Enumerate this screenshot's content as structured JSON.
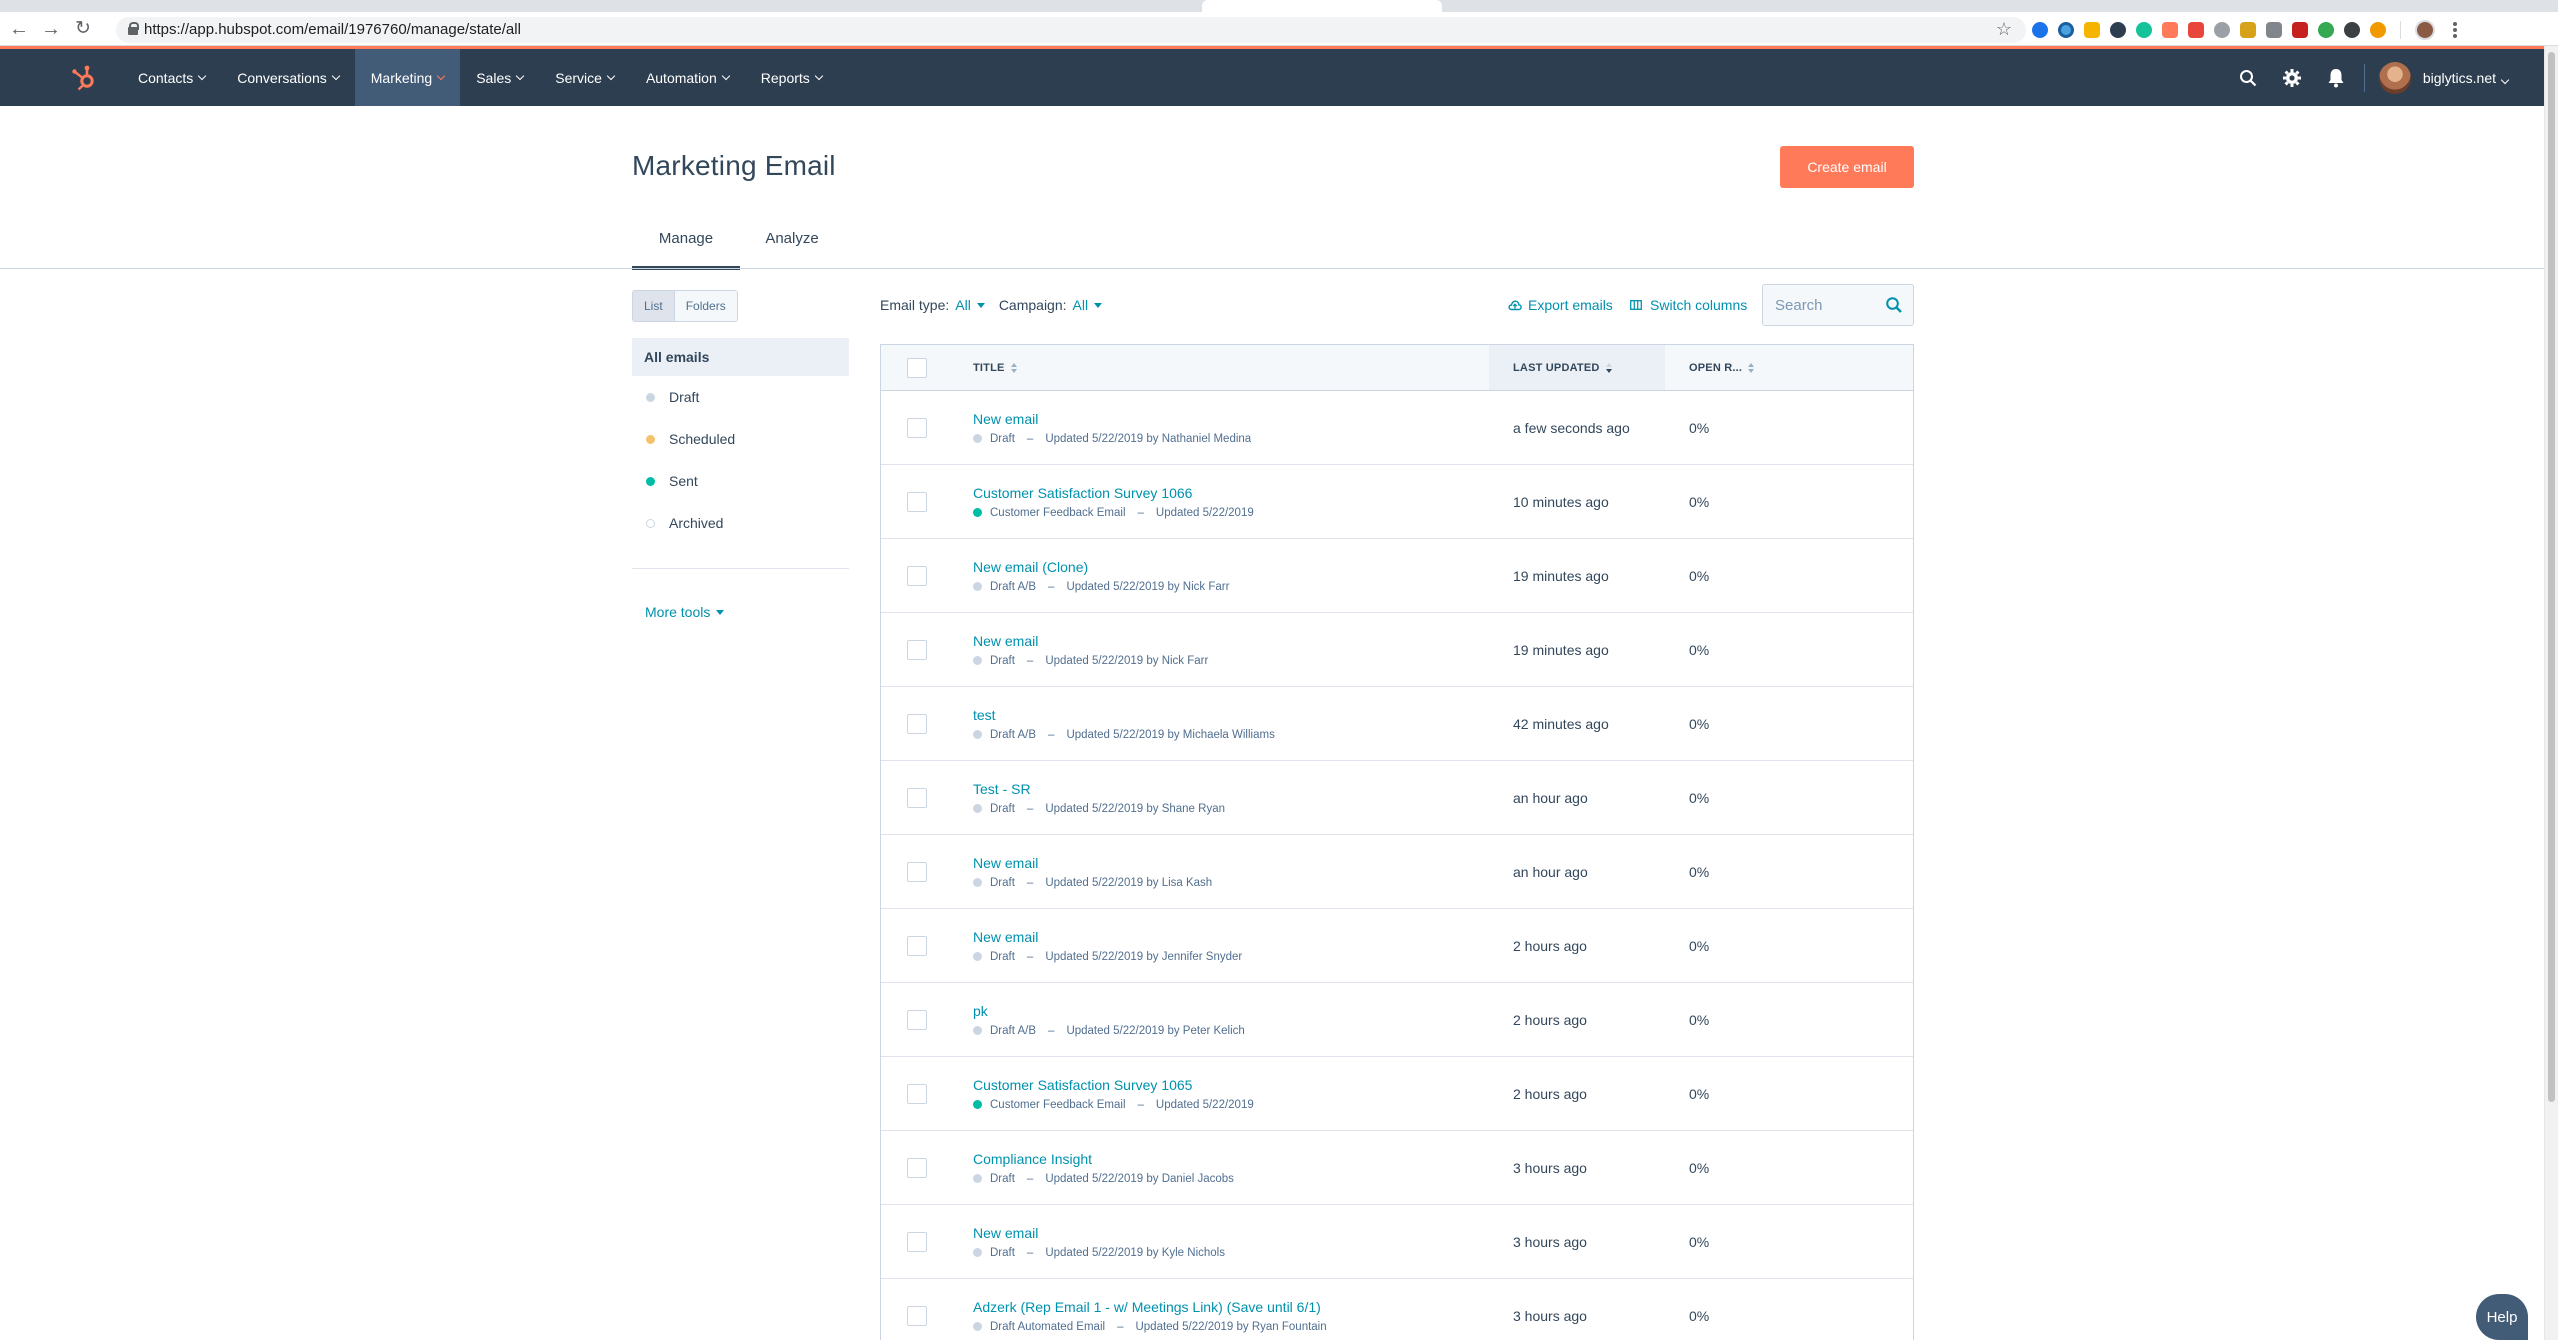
{
  "browser": {
    "url": "https://app.hubspot.com/email/1976760/manage/state/all"
  },
  "nav": {
    "items": [
      {
        "label": "Contacts",
        "name": "nav-contacts"
      },
      {
        "label": "Conversations",
        "name": "nav-conversations"
      },
      {
        "label": "Marketing",
        "name": "nav-marketing",
        "active": true
      },
      {
        "label": "Sales",
        "name": "nav-sales"
      },
      {
        "label": "Service",
        "name": "nav-service"
      },
      {
        "label": "Automation",
        "name": "nav-automation"
      },
      {
        "label": "Reports",
        "name": "nav-reports"
      }
    ],
    "account": "biglytics.net"
  },
  "page": {
    "title": "Marketing Email",
    "create_button": "Create email",
    "tabs": [
      "Manage",
      "Analyze"
    ]
  },
  "sidebar": {
    "toggle": [
      "List",
      "Folders"
    ],
    "items": [
      {
        "label": "All emails",
        "dot": ""
      },
      {
        "label": "Draft",
        "dot": "#cbd6e2"
      },
      {
        "label": "Scheduled",
        "dot": "#f5c26b"
      },
      {
        "label": "Sent",
        "dot": "#00bda5"
      },
      {
        "label": "Archived",
        "dot": "outline"
      }
    ],
    "more_tools": "More tools"
  },
  "filters": {
    "email_type_label": "Email type:",
    "email_type_value": "All",
    "campaign_label": "Campaign:",
    "campaign_value": "All",
    "export": "Export emails",
    "switch_columns": "Switch columns",
    "search_placeholder": "Search"
  },
  "table": {
    "headers": {
      "title": "TITLE",
      "last_updated": "LAST UPDATED",
      "open_rate": "OPEN R..."
    },
    "rows": [
      {
        "title": "New email",
        "status": "Draft",
        "dot": "#cbd6e2",
        "updated": "Updated 5/22/2019 by Nathaniel Medina",
        "last_updated": "a few seconds ago",
        "open_rate": "0%"
      },
      {
        "title": "Customer Satisfaction Survey 1066",
        "status": "Customer Feedback Email",
        "dot": "#00bda5",
        "updated": "Updated 5/22/2019",
        "last_updated": "10 minutes ago",
        "open_rate": "0%"
      },
      {
        "title": "New email (Clone)",
        "status": "Draft A/B",
        "dot": "#cbd6e2",
        "updated": "Updated 5/22/2019 by Nick Farr",
        "last_updated": "19 minutes ago",
        "open_rate": "0%"
      },
      {
        "title": "New email",
        "status": "Draft",
        "dot": "#cbd6e2",
        "updated": "Updated 5/22/2019 by Nick Farr",
        "last_updated": "19 minutes ago",
        "open_rate": "0%"
      },
      {
        "title": "test",
        "status": "Draft A/B",
        "dot": "#cbd6e2",
        "updated": "Updated 5/22/2019 by Michaela Williams",
        "last_updated": "42 minutes ago",
        "open_rate": "0%"
      },
      {
        "title": "Test - SR",
        "status": "Draft",
        "dot": "#cbd6e2",
        "updated": "Updated 5/22/2019 by Shane Ryan",
        "last_updated": "an hour ago",
        "open_rate": "0%"
      },
      {
        "title": "New email",
        "status": "Draft",
        "dot": "#cbd6e2",
        "updated": "Updated 5/22/2019 by Lisa Kash",
        "last_updated": "an hour ago",
        "open_rate": "0%"
      },
      {
        "title": "New email",
        "status": "Draft",
        "dot": "#cbd6e2",
        "updated": "Updated 5/22/2019 by Jennifer Snyder",
        "last_updated": "2 hours ago",
        "open_rate": "0%"
      },
      {
        "title": "pk",
        "status": "Draft A/B",
        "dot": "#cbd6e2",
        "updated": "Updated 5/22/2019 by Peter Kelich",
        "last_updated": "2 hours ago",
        "open_rate": "0%"
      },
      {
        "title": "Customer Satisfaction Survey 1065",
        "status": "Customer Feedback Email",
        "dot": "#00bda5",
        "updated": "Updated 5/22/2019",
        "last_updated": "2 hours ago",
        "open_rate": "0%"
      },
      {
        "title": "Compliance Insight",
        "status": "Draft",
        "dot": "#cbd6e2",
        "updated": "Updated 5/22/2019 by Daniel Jacobs",
        "last_updated": "3 hours ago",
        "open_rate": "0%"
      },
      {
        "title": "New email",
        "status": "Draft",
        "dot": "#cbd6e2",
        "updated": "Updated 5/22/2019 by Kyle Nichols",
        "last_updated": "3 hours ago",
        "open_rate": "0%"
      },
      {
        "title": "Adzerk (Rep Email 1 - w/ Meetings Link) (Save until 6/1)",
        "status": "Draft Automated Email",
        "dot": "#cbd6e2",
        "updated": "Updated 5/22/2019 by Ryan Fountain",
        "last_updated": "3 hours ago",
        "open_rate": "0%"
      }
    ]
  },
  "help": "Help",
  "colors": {
    "accent": "#ff7a59",
    "nav_bg": "#2d3e50",
    "link": "#0091ae",
    "sent": "#00bda5",
    "scheduled": "#f5c26b"
  },
  "icons": [
    "back-icon",
    "forward-icon",
    "reload-icon",
    "lock-icon",
    "bookmark-star-icon",
    "hubspot-logo-icon",
    "search-icon",
    "settings-gear-icon",
    "notifications-bell-icon",
    "cloud-export-icon",
    "columns-icon"
  ]
}
